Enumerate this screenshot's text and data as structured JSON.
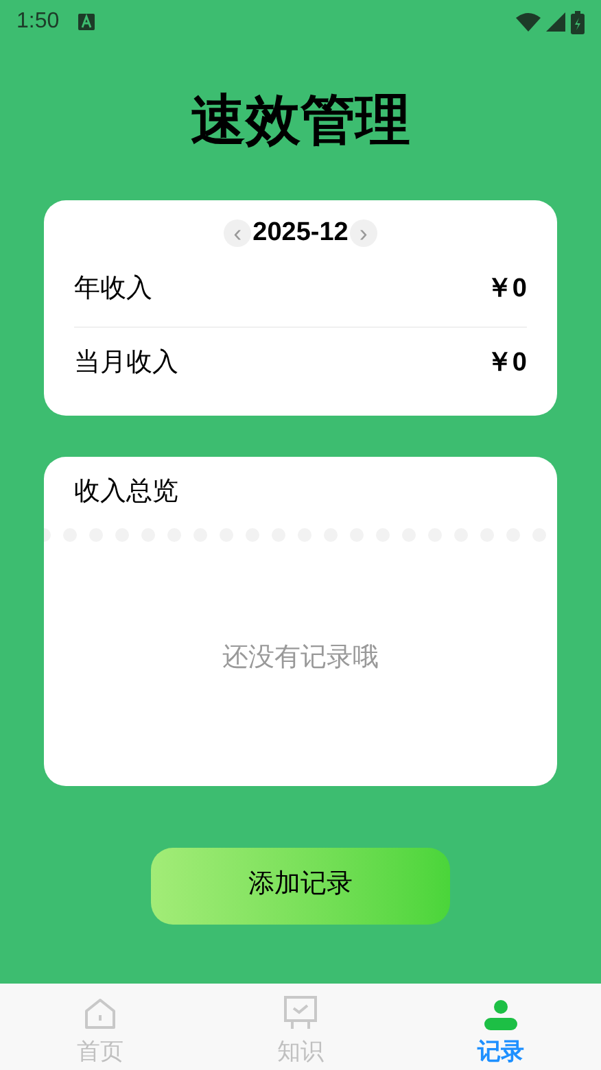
{
  "status_bar": {
    "time": "1:50"
  },
  "title": "速效管理",
  "summary": {
    "month": "2025-12",
    "prev": "‹",
    "next": "›",
    "rows": [
      {
        "label": "年收入",
        "value": "￥0"
      },
      {
        "label": "当月收入",
        "value": "￥0"
      }
    ]
  },
  "overview": {
    "title": "收入总览",
    "empty": "还没有记录哦"
  },
  "add_button": "添加记录",
  "tabs": [
    {
      "label": "首页",
      "kind": "home",
      "selected": false
    },
    {
      "label": "知识",
      "kind": "board",
      "selected": false
    },
    {
      "label": "记录",
      "kind": "person",
      "selected": true
    }
  ]
}
